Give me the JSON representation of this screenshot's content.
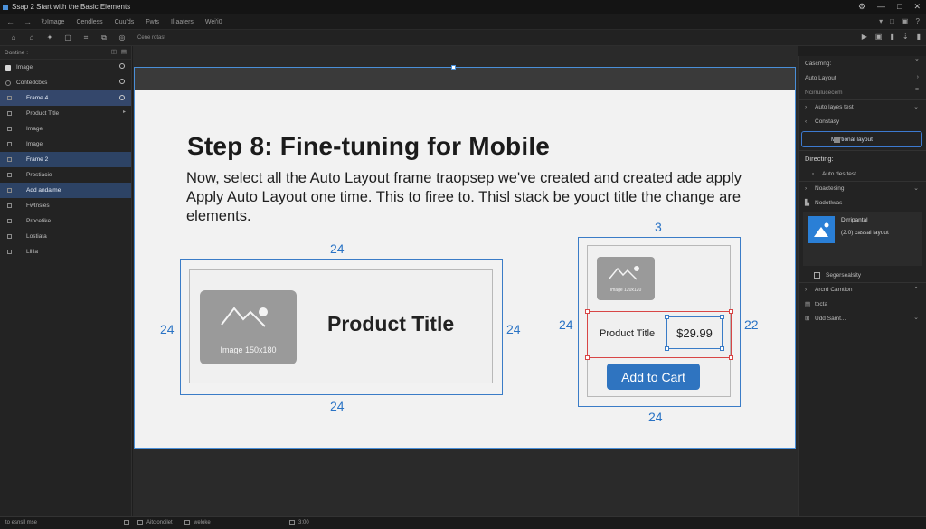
{
  "window": {
    "title": "Ssap 2 Start with the Basic Elements",
    "controls": [
      "⚙",
      "—",
      "□",
      "✕"
    ]
  },
  "menubar": {
    "nav": [
      "←",
      "→",
      "↻"
    ],
    "items": [
      "Image",
      "Cendless",
      "Cuu'ds",
      "Fwts",
      "Il aaters",
      "Wei'i0"
    ],
    "right_icons": [
      "▾",
      "□",
      "▣",
      "?"
    ]
  },
  "toolbar": {
    "tools": [
      "⌂",
      "⌂",
      "✦",
      "▢",
      "⌗",
      "⧉",
      "◎"
    ],
    "canvas_label": "Cene rotast",
    "right_icons": [
      "▶",
      "▣",
      "▮",
      "⇣",
      "▮"
    ]
  },
  "left_panel": {
    "section_label": "Dontine :",
    "image_row": "Image",
    "components_label": "Contedcbcs",
    "layers": [
      {
        "label": "Frame 4",
        "selected": true
      },
      {
        "label": "Product Title",
        "selected": false
      },
      {
        "label": "Image",
        "selected": false
      },
      {
        "label": "Image",
        "selected": false
      },
      {
        "label": "Frame 2",
        "selected": true
      },
      {
        "label": "Prostiacie",
        "selected": false
      },
      {
        "label": "Add andalme",
        "selected": true
      },
      {
        "label": "Fwtnsies",
        "selected": false
      },
      {
        "label": "Procetike",
        "selected": false
      },
      {
        "label": "Lostiata",
        "selected": false
      },
      {
        "label": "Liiila",
        "selected": false
      }
    ]
  },
  "slide": {
    "heading": "Step 8: Fine-tuning for Mobile",
    "body": "Now, select all the Auto Layout frame traopsep we've created and created ade apply Apply Auto Layout one time. This to firee to. Thisl stack be youct title the change are elements.",
    "example_desktop": {
      "padding_top": "24",
      "padding_left": "24",
      "padding_right": "24",
      "padding_bottom": "24",
      "image_caption": "Image 150x180",
      "product_title": "Product Title"
    },
    "example_mobile": {
      "padding_top": "3",
      "padding_left": "24",
      "padding_right": "22",
      "padding_bottom": "24",
      "image_caption": "Image 120x120",
      "product_title": "Product Title",
      "price": "$29.99",
      "button_label": "Add to Cart"
    }
  },
  "right_panel": {
    "header": "Cascmng:",
    "auto_layout": "Auto Layout",
    "auto_layout_sub": "Ncirrulucecem",
    "auto_layout_test": "Auto layes test",
    "spacing": "Constasy",
    "selected_option": "Mertional layout",
    "directing_label": "Directing:",
    "auto_dir_test": "Auto des test",
    "nonctesing": "Noactesing",
    "nodeties": "Nodotlwas",
    "card_title": "Dirripantal",
    "card_sub": "(2.0) cassal layout",
    "checkbox_label": "Segersealsity",
    "avoid_caption": "Arcrd Camtion",
    "toota": "tocta",
    "udd_samt": "Udd Samt..."
  },
  "statusbar": {
    "left": "to esnsll mse",
    "mid1": "Aitcioncilet",
    "mid2": "weloke",
    "mid3": "3:00"
  }
}
